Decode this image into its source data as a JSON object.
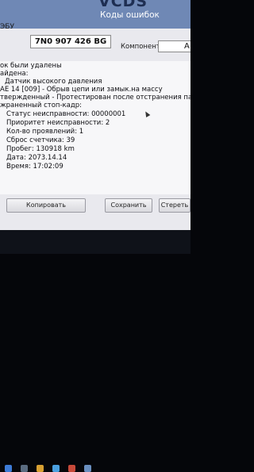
{
  "header": {
    "logo": "VCDS",
    "window_title": "Коды ошибок",
    "ecu_label": "ЭБУ",
    "part_number": "7N0 907 426 BG",
    "component_label": "Компонент:",
    "component_value": "A"
  },
  "log_lines": [
    "ок были удалены",
    "айдена:",
    "Датчик высокого давления",
    "AE 14 [009] - Обрыв цепи или замык.на массу",
    "твержденный - Протестирован после отстранения памяти",
    "жраненный стоп-кадр:",
    "Статус неисправности: 00000001",
    "Приоритет неисправности: 2",
    "Кол-во проявлений: 1",
    "Сброс счетчика: 39",
    "Пробег: 130918 km",
    "Дата: 2073.14.14",
    "Время: 17:02:09"
  ],
  "buttons": {
    "copy": "Копировать",
    "save": "Сохранить",
    "clear": "Стереть"
  },
  "colors": {
    "title_band": "#6f88b5",
    "screen_bg": "#e9e9ee"
  }
}
